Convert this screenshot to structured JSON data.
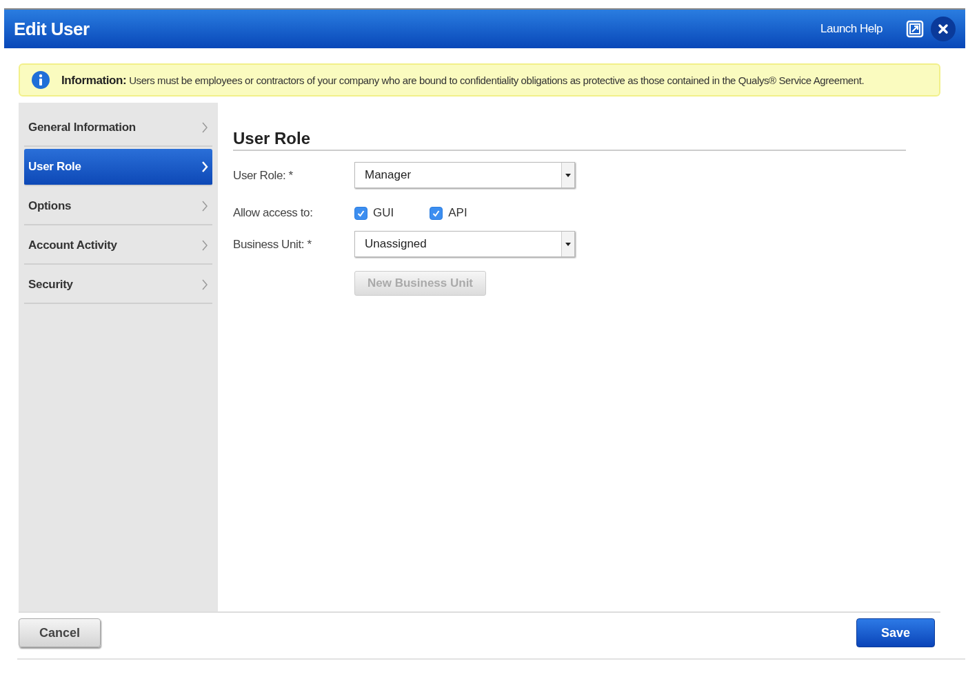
{
  "window": {
    "title": "Edit User",
    "help_link": "Launch Help"
  },
  "info": {
    "text": "**Information:** Users must be employees or contractors of your company who are bound to confidentiality obligations as protective as those contained in the Qualys® Service Agreement."
  },
  "sidebar": {
    "items": [
      {
        "label": "General Information",
        "selected": false
      },
      {
        "label": "User Role",
        "selected": true
      },
      {
        "label": "Options",
        "selected": false
      },
      {
        "label": "Account Activity",
        "selected": false
      },
      {
        "label": "Security",
        "selected": false
      }
    ]
  },
  "section": {
    "title": "User Role",
    "user_role": {
      "label": "User Role: *",
      "value": "Manager"
    },
    "access": {
      "label": "Allow access to:",
      "options": [
        {
          "label": "GUI",
          "checked": true
        },
        {
          "label": "API",
          "checked": true
        }
      ]
    },
    "business_unit": {
      "label": "Business Unit: *",
      "value": "Unassigned"
    },
    "new_unit_button": {
      "label": "New Business Unit",
      "disabled": true
    }
  },
  "footer": {
    "cancel": "Cancel",
    "save": "Save"
  }
}
